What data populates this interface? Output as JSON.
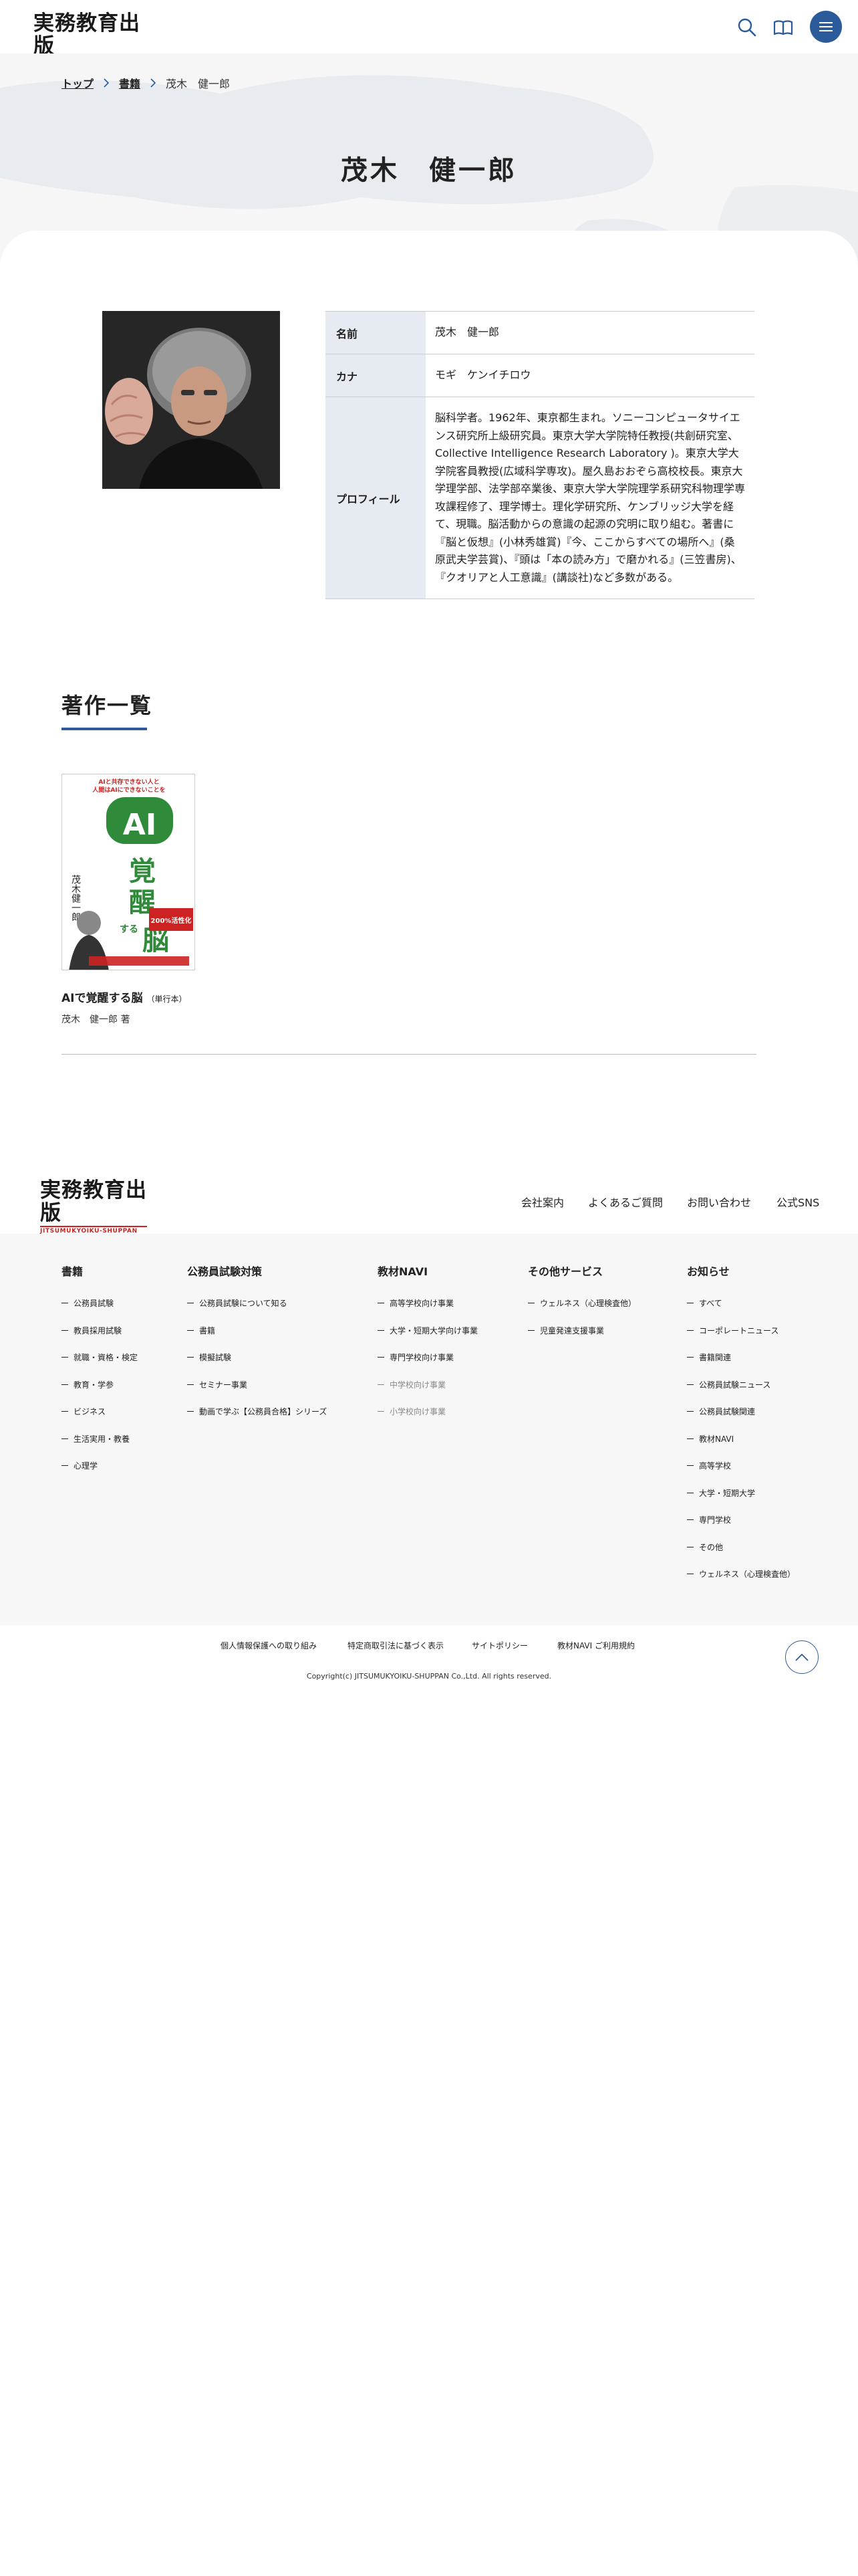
{
  "header": {
    "logo_main": "実務教育出版",
    "logo_sub": "JITSUMUKYOIKU-SHUPPAN",
    "icons": [
      "search-icon",
      "book-icon",
      "menu-icon"
    ]
  },
  "breadcrumb": {
    "items": [
      "トップ",
      "書籍"
    ],
    "current": "茂木　健一郎"
  },
  "page": {
    "title": "茂木　健一郎"
  },
  "profile": {
    "rows": [
      {
        "label": "名前",
        "value": "茂木　健一郎"
      },
      {
        "label": "カナ",
        "value": "モギ　ケンイチロウ"
      },
      {
        "label": "プロフィール",
        "value": "脳科学者。1962年、東京都生まれ。ソニーコンピュータサイエンス研究所上級研究員。東京大学大学院特任教授(共創研究室、Collective Intelligence Research Laboratory )。東京大学大学院客員教授(広域科学専攻)。屋久島おおぞら高校校長。東京大学理学部、法学部卒業後、東京大学大学院理学系研究科物理学専攻課程修了、理学博士。理化学研究所、ケンブリッジ大学を経て、現職。脳活動からの意識の起源の究明に取り組む。著書に『脳と仮想』(小林秀雄賞)『今、ここからすべての場所へ』(桑原武夫学芸賞)、『頭は「本の読み方」で磨かれる』(三笠書房)、『クオリアと人工意識』(講談社)など多数がある。"
      }
    ]
  },
  "works": {
    "title": "著作一覧",
    "books": [
      {
        "title": "AIで覚醒する脳",
        "type": "（単行本）",
        "author": "茂木　健一郎 著",
        "cover": {
          "top_line": "AIと共存できない人と",
          "top_line2": "人間はAIにできないことを",
          "big": "AIで覚醒する脳",
          "author_vert": "茂木健一郎",
          "badge": "200%活性化"
        }
      }
    ]
  },
  "footer": {
    "nav": [
      "会社案内",
      "よくあるご質問",
      "お問い合わせ",
      "公式SNS"
    ],
    "columns": [
      {
        "title": "書籍",
        "items": [
          "公務員試験",
          "教員採用試験",
          "就職・資格・検定",
          "教育・学参",
          "ビジネス",
          "生活実用・教養",
          "心理学"
        ]
      },
      {
        "title": "公務員試験対策",
        "items": [
          "公務員試験について知る",
          "書籍",
          "模擬試験",
          "セミナー事業",
          "動画で学ぶ【公務員合格】シリーズ"
        ]
      },
      {
        "title": "教材NAVI",
        "items": [
          "高等学校向け事業",
          "大学・短期大学向け事業",
          "専門学校向け事業",
          "中学校向け事業",
          "小学校向け事業"
        ],
        "muted_from": 3
      },
      {
        "title": "その他サービス",
        "items": [
          "ウェルネス（心理検査他）",
          "児童発達支援事業"
        ]
      },
      {
        "title": "お知らせ",
        "items": [
          "すべて",
          "コーポレートニュース",
          "書籍関連",
          "公務員試験ニュース",
          "公務員試験関連",
          "教材NAVI",
          "高等学校",
          "大学・短期大学",
          "専門学校",
          "その他",
          "ウェルネス（心理検査他）"
        ]
      }
    ],
    "bottom_links": [
      "個人情報保護への取り組み",
      "特定商取引法に基づく表示",
      "サイトポリシー",
      "教材NAVI ご利用規約"
    ],
    "copyright": "Copyright(c) JITSUMUKYOIKU-SHUPPAN Co.,Ltd. All rights reserved.",
    "pagetop_icon": "chevron-up-icon"
  },
  "colors": {
    "accent": "#2c5b9c",
    "table_header": "#e6eaf1",
    "logo_red": "#cc2222",
    "bg_gray": "#f6f6f6"
  }
}
